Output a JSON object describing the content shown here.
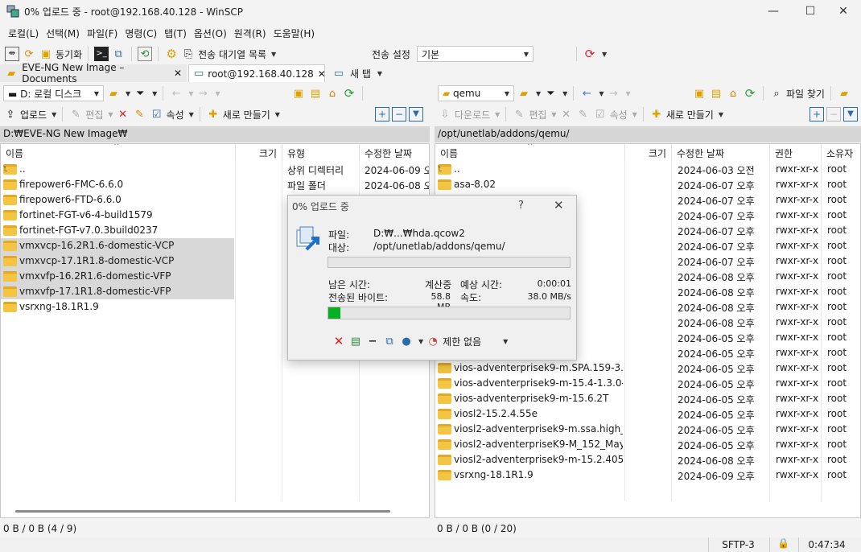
{
  "window": {
    "title": "0% 업로드 중 - root@192.168.40.128 - WinSCP"
  },
  "menu": [
    "로컬(L)",
    "선택(M)",
    "파일(F)",
    "명령(C)",
    "탭(T)",
    "옵션(O)",
    "원격(R)",
    "도움말(H)"
  ],
  "toolbar": {
    "sync_label": "동기화",
    "queue_label": "전송 대기열 목록",
    "transfer_settings_label": "전송 설정",
    "transfer_settings_value": "기본"
  },
  "tabs": [
    {
      "label": "EVE-NG New Image – Documents"
    },
    {
      "label": "root@192.168.40.128"
    },
    {
      "label": "새 탭"
    }
  ],
  "left": {
    "drive": "D: 로컬 디스크",
    "upload_label": "업로드",
    "edit_label": "편집",
    "props_label": "속성",
    "new_label": "새로 만들기",
    "path": "D:₩EVE-NG New Image₩",
    "headers": {
      "name": "이름",
      "size": "크기",
      "type": "유형",
      "modified": "수정한 날짜"
    },
    "rows": [
      {
        "name": "..",
        "size": "",
        "type": "상위 디렉터리",
        "modified": "2024-06-09 오",
        "up": true
      },
      {
        "name": "firepower6-FMC-6.6.0",
        "size": "",
        "type": "파일 폴더",
        "modified": "2024-06-08 오"
      },
      {
        "name": "firepower6-FTD-6.6.0",
        "size": "",
        "type": "",
        "modified": ""
      },
      {
        "name": "fortinet-FGT-v6-4-build1579",
        "size": "",
        "type": "",
        "modified": ""
      },
      {
        "name": "fortinet-FGT-v7.0.3build0237",
        "size": "",
        "type": "",
        "modified": ""
      },
      {
        "name": "vmxvcp-16.2R1.6-domestic-VCP",
        "size": "",
        "type": "",
        "modified": "",
        "selected": true
      },
      {
        "name": "vmxvcp-17.1R1.8-domestic-VCP",
        "size": "",
        "type": "",
        "modified": "",
        "selected": true
      },
      {
        "name": "vmxvfp-16.2R1.6-domestic-VFP",
        "size": "",
        "type": "",
        "modified": "",
        "selected": true
      },
      {
        "name": "vmxvfp-17.1R1.8-domestic-VFP",
        "size": "",
        "type": "",
        "modified": "",
        "selected": true
      },
      {
        "name": "vsrxng-18.1R1.9",
        "size": "",
        "type": "",
        "modified": ""
      }
    ],
    "status": "0 B / 0 B (4 / 9)"
  },
  "right": {
    "folder": "qemu",
    "find_label": "파일 찾기",
    "download_label": "다운로드",
    "edit_label": "편집",
    "props_label": "속성",
    "new_label": "새로 만들기",
    "path": "/opt/unetlab/addons/qemu/",
    "headers": {
      "name": "이름",
      "size": "크기",
      "modified": "수정한 날짜",
      "rights": "권한",
      "owner": "소유자"
    },
    "rows": [
      {
        "name": "..",
        "modified": "2024-06-03 오전",
        "rights": "rwxr-xr-x",
        "owner": "root",
        "up": true
      },
      {
        "name": "asa-8.02",
        "modified": "2024-06-07 오후",
        "rights": "rwxr-xr-x",
        "owner": "root"
      },
      {
        "name": "",
        "modified": "2024-06-07 오후",
        "rights": "rwxr-xr-x",
        "owner": "root"
      },
      {
        "name": "",
        "modified": "2024-06-07 오후",
        "rights": "rwxr-xr-x",
        "owner": "root"
      },
      {
        "name": "",
        "modified": "2024-06-07 오후",
        "rights": "rwxr-xr-x",
        "owner": "root"
      },
      {
        "name": "",
        "modified": "2024-06-07 오후",
        "rights": "rwxr-xr-x",
        "owner": "root"
      },
      {
        "name": "",
        "modified": "2024-06-07 오후",
        "rights": "rwxr-xr-x",
        "owner": "root"
      },
      {
        "name": "",
        "modified": "2024-06-08 오후",
        "rights": "rwxr-xr-x",
        "owner": "root"
      },
      {
        "name": "",
        "modified": "2024-06-08 오후",
        "rights": "rwxr-xr-x",
        "owner": "root"
      },
      {
        "name": "",
        "modified": "2024-06-08 오후",
        "rights": "rwxr-xr-x",
        "owner": "root"
      },
      {
        "name": "",
        "modified": "2024-06-08 오후",
        "rights": "rwxr-xr-x",
        "owner": "root"
      },
      {
        "name": "154-3M8",
        "modified": "2024-06-05 오후",
        "rights": "rwxr-xr-x",
        "owner": "root"
      },
      {
        "name": "159-3.m2",
        "modified": "2024-06-05 오후",
        "rights": "rwxr-xr-x",
        "owner": "root"
      },
      {
        "name": "vios-adventerprisek9-m.SPA.159-3.M3",
        "modified": "2024-06-05 오후",
        "rights": "rwxr-xr-x",
        "owner": "root"
      },
      {
        "name": "vios-adventerprisek9-m-15.4-1.3.0-1...",
        "modified": "2024-06-05 오후",
        "rights": "rwxr-xr-x",
        "owner": "root"
      },
      {
        "name": "vios-adventerprisek9-m-15.6.2T",
        "modified": "2024-06-05 오후",
        "rights": "rwxr-xr-x",
        "owner": "root"
      },
      {
        "name": "viosl2-15.2.4.55e",
        "modified": "2024-06-05 오후",
        "rights": "rwxr-xr-x",
        "owner": "root"
      },
      {
        "name": "viosl2-adventerprisek9-m.ssa.high_iro...",
        "modified": "2024-06-05 오후",
        "rights": "rwxr-xr-x",
        "owner": "root"
      },
      {
        "name": "viosl2-adventerpriseK9-M_152_May_...",
        "modified": "2024-06-05 오후",
        "rights": "rwxr-xr-x",
        "owner": "root"
      },
      {
        "name": "viosl2-adventerprisek9-m-15.2.4055",
        "modified": "2024-06-08 오후",
        "rights": "rwxr-xr-x",
        "owner": "root"
      },
      {
        "name": "vsrxng-18.1R1.9",
        "modified": "2024-06-09 오후",
        "rights": "rwxr-xr-x",
        "owner": "root"
      }
    ],
    "status": "0 B / 0 B (0 / 20)"
  },
  "bottom": {
    "protocol": "SFTP-3",
    "time": "0:47:34"
  },
  "dialog": {
    "title": "0% 업로드 중",
    "help": "?",
    "file_label": "파일:",
    "file_value": "D:₩...₩hda.qcow2",
    "target_label": "대상:",
    "target_value": "/opt/unetlab/addons/qemu/",
    "file_progress": 0,
    "remaining_label": "남은 시간:",
    "remaining_value": "계산중",
    "estimated_label": "예상 시간:",
    "estimated_value": "0:00:01",
    "transferred_label": "전송된 바이트:",
    "transferred_value": "58.8 MB",
    "speed_label": "속도:",
    "speed_value": "38.0 MB/s",
    "total_progress": 0.05,
    "limit_label": "제한 없음"
  },
  "colors": {
    "accent": "#06b025",
    "folder": "#f4c542",
    "selected": "#d8d8d8"
  }
}
